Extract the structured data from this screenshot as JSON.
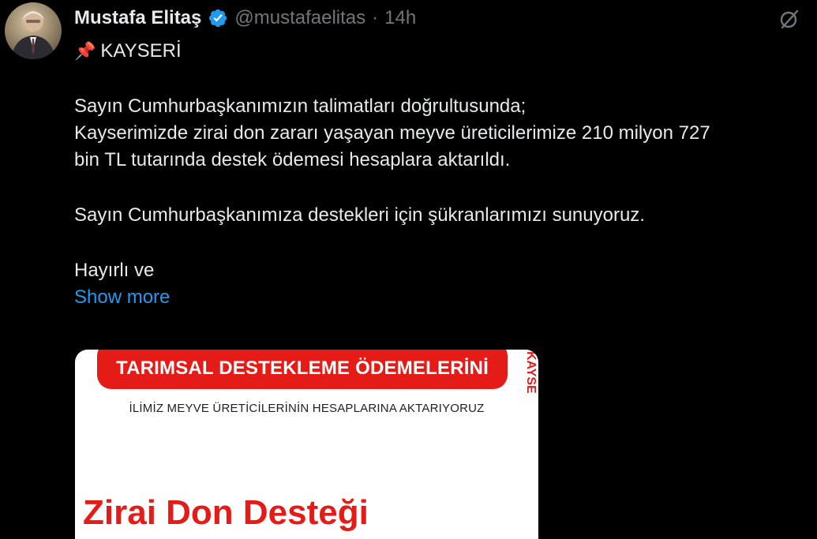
{
  "tweet": {
    "author_name": "Mustafa Elitaş",
    "handle": "@mustafaelitas",
    "separator": "·",
    "time": "14h",
    "lines": [
      "KAYSERİ",
      "Sayın Cumhurbaşkanımızın talimatları doğrultusunda;",
      "Kayserimizde zirai don zararı yaşayan meyve üreticilerimize 210 milyon 727",
      "bin TL tutarında destek ödemesi hesaplara aktarıldı.",
      "Sayın Cumhurbaşkanımıza destekleri için şükranlarımızı sunuyoruz.",
      "Hayırlı ve"
    ],
    "show_more": "Show more"
  },
  "media": {
    "banner": "TARIMSAL DESTEKLEME ÖDEMELERİNİ",
    "side_label": "KAYSE",
    "subline": "İLİMİZ MEYVE ÜRETİCİLERİNİN HESAPLARINA AKTARIYORUZ",
    "big_title": "Zirai Don Desteği"
  },
  "icons": {
    "pin": "pushpin-icon",
    "verified": "verified-badge-icon",
    "grok": "grok-icon"
  },
  "colors": {
    "background": "#000000",
    "text": "#e7e9ea",
    "muted": "#71767b",
    "link": "#1d9bf0",
    "verified": "#1d9bf0",
    "banner_red": "#e41b17"
  }
}
